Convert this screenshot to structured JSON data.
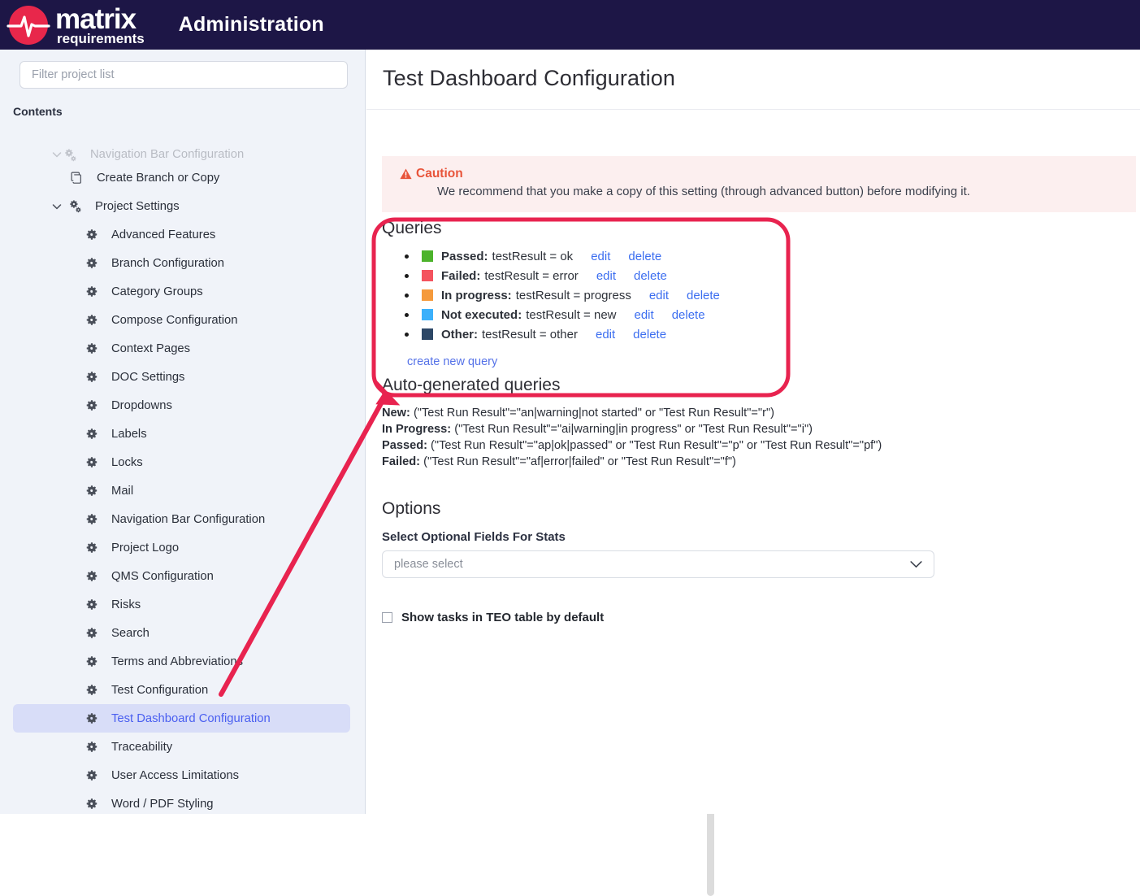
{
  "header": {
    "logo_primary": "matrix",
    "logo_secondary": "requirements",
    "logo_icon": "pulse-circle-logo",
    "app_title": "Administration",
    "bar_color": "#1d1646",
    "logo_color": "#e8274b"
  },
  "sidebar": {
    "filter_placeholder": "Filter project list",
    "filter_value": "",
    "contents_label": "Contents",
    "clipped_top_label": "Navigation Bar Configuration",
    "items": [
      {
        "label": "Create Branch or Copy",
        "icon": "copy-icon",
        "level": 2,
        "selected": false,
        "expander": ""
      },
      {
        "label": "Project Settings",
        "icon": "cogs-icon",
        "level": 1,
        "selected": false,
        "expander": "chevron-down-icon"
      },
      {
        "label": "Advanced Features",
        "icon": "gear-icon",
        "level": 3,
        "selected": false,
        "expander": ""
      },
      {
        "label": "Branch Configuration",
        "icon": "gear-icon",
        "level": 3,
        "selected": false,
        "expander": ""
      },
      {
        "label": "Category Groups",
        "icon": "gear-icon",
        "level": 3,
        "selected": false,
        "expander": ""
      },
      {
        "label": "Compose Configuration",
        "icon": "gear-icon",
        "level": 3,
        "selected": false,
        "expander": ""
      },
      {
        "label": "Context Pages",
        "icon": "gear-icon",
        "level": 3,
        "selected": false,
        "expander": ""
      },
      {
        "label": "DOC Settings",
        "icon": "gear-icon",
        "level": 3,
        "selected": false,
        "expander": ""
      },
      {
        "label": "Dropdowns",
        "icon": "gear-icon",
        "level": 3,
        "selected": false,
        "expander": ""
      },
      {
        "label": "Labels",
        "icon": "gear-icon",
        "level": 3,
        "selected": false,
        "expander": ""
      },
      {
        "label": "Locks",
        "icon": "gear-icon",
        "level": 3,
        "selected": false,
        "expander": ""
      },
      {
        "label": "Mail",
        "icon": "gear-icon",
        "level": 3,
        "selected": false,
        "expander": ""
      },
      {
        "label": "Navigation Bar Configuration",
        "icon": "gear-icon",
        "level": 3,
        "selected": false,
        "expander": ""
      },
      {
        "label": "Project Logo",
        "icon": "gear-icon",
        "level": 3,
        "selected": false,
        "expander": ""
      },
      {
        "label": "QMS Configuration",
        "icon": "gear-icon",
        "level": 3,
        "selected": false,
        "expander": ""
      },
      {
        "label": "Risks",
        "icon": "gear-icon",
        "level": 3,
        "selected": false,
        "expander": ""
      },
      {
        "label": "Search",
        "icon": "gear-icon",
        "level": 3,
        "selected": false,
        "expander": ""
      },
      {
        "label": "Terms and Abbreviations",
        "icon": "gear-icon",
        "level": 3,
        "selected": false,
        "expander": ""
      },
      {
        "label": "Test Configuration",
        "icon": "gear-icon",
        "level": 3,
        "selected": false,
        "expander": ""
      },
      {
        "label": "Test Dashboard Configuration",
        "icon": "gear-icon",
        "level": 3,
        "selected": true,
        "expander": ""
      },
      {
        "label": "Traceability",
        "icon": "gear-icon",
        "level": 3,
        "selected": false,
        "expander": ""
      },
      {
        "label": "User Access Limitations",
        "icon": "gear-icon",
        "level": 3,
        "selected": false,
        "expander": ""
      },
      {
        "label": "Word / PDF Styling",
        "icon": "gear-icon",
        "level": 3,
        "selected": false,
        "expander": ""
      }
    ],
    "selected_item_color": "#4a5ff0",
    "selected_item_bg": "#d8ddf8"
  },
  "main": {
    "page_title": "Test Dashboard Configuration",
    "caution": {
      "icon": "warning-triangle-icon",
      "title": "Caution",
      "body": "We recommend that you make a copy of this setting (through advanced button) before modifying it.",
      "bg": "#fcefef",
      "title_color": "#e8543a"
    },
    "queries": {
      "heading": "Queries",
      "items": [
        {
          "color": "#4cb32b",
          "name": "Passed:",
          "expression": "testResult = ok",
          "edit": "edit",
          "delete": "delete"
        },
        {
          "color": "#f4535e",
          "name": "Failed:",
          "expression": "testResult = error",
          "edit": "edit",
          "delete": "delete"
        },
        {
          "color": "#f59a3c",
          "name": "In progress:",
          "expression": "testResult = progress",
          "edit": "edit",
          "delete": "delete"
        },
        {
          "color": "#3bb0fb",
          "name": "Not executed:",
          "expression": "testResult = new",
          "edit": "edit",
          "delete": "delete"
        },
        {
          "color": "#2d4766",
          "name": "Other:",
          "expression": "testResult = other",
          "edit": "edit",
          "delete": "delete"
        }
      ],
      "create_link": "create new query"
    },
    "autogen": {
      "heading": "Auto-generated queries",
      "lines": [
        {
          "name": "New:",
          "expression": "(\"Test Run Result\"=\"an|warning|not started\" or \"Test Run Result\"=\"r\")"
        },
        {
          "name": "In Progress:",
          "expression": "(\"Test Run Result\"=\"ai|warning|in progress\" or \"Test Run Result\"=\"i\")"
        },
        {
          "name": "Passed:",
          "expression": "(\"Test Run Result\"=\"ap|ok|passed\" or \"Test Run Result\"=\"p\" or \"Test Run Result\"=\"pf\")"
        },
        {
          "name": "Failed:",
          "expression": "(\"Test Run Result\"=\"af|error|failed\" or \"Test Run Result\"=\"f\")"
        }
      ]
    },
    "options": {
      "heading": "Options",
      "select_label": "Select Optional Fields For Stats",
      "select_value": "please select",
      "select_icon": "chevron-down-icon",
      "checkbox_label": "Show tasks in TEO table by default",
      "checkbox_checked": false
    }
  },
  "annotation": {
    "highlight_color": "#e8234f",
    "highlight_target": "queries-section",
    "arrow_from": "sidebar-item-test-dashboard-configuration",
    "arrow_to": "queries-section"
  }
}
